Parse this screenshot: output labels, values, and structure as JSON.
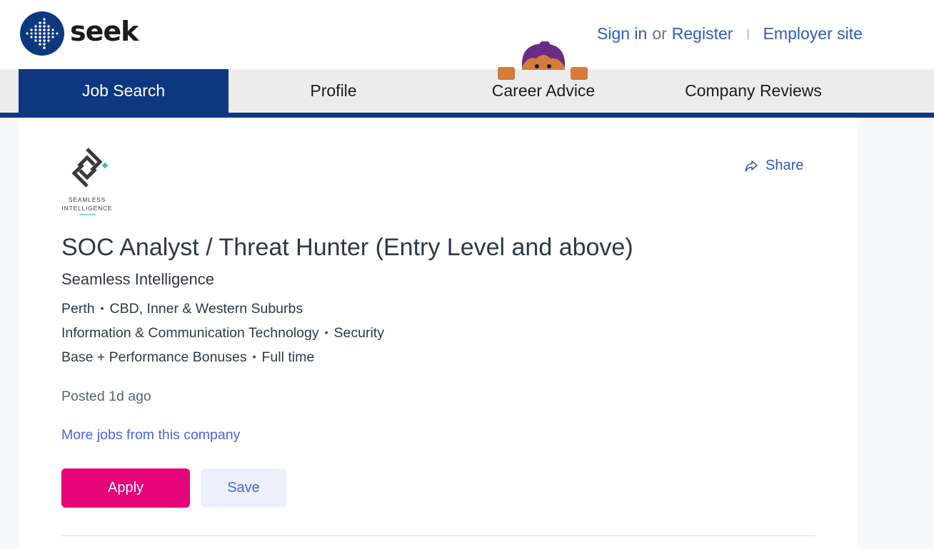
{
  "header": {
    "logo_text": "seek",
    "sign_in": "Sign in",
    "or": "or",
    "register": "Register",
    "separator": "|",
    "employer_site": "Employer site"
  },
  "nav": {
    "tabs": [
      {
        "label": "Job Search",
        "active": true
      },
      {
        "label": "Profile",
        "active": false
      },
      {
        "label": "Career Advice",
        "active": false
      },
      {
        "label": "Company Reviews",
        "active": false
      }
    ]
  },
  "job": {
    "company_logo_text_line1": "SEAMLESS",
    "company_logo_text_line2": "INTELLIGENCE",
    "share_label": "Share",
    "title": "SOC Analyst / Threat Hunter (Entry Level and above)",
    "company": "Seamless Intelligence",
    "location": "Perth",
    "area": "CBD, Inner & Western Suburbs",
    "classification": "Information & Communication Technology",
    "subclassification": "Security",
    "salary": "Base + Performance Bonuses",
    "work_type": "Full time",
    "posted": "Posted 1d ago",
    "more_jobs": "More jobs from this company",
    "apply_label": "Apply",
    "save_label": "Save"
  },
  "colors": {
    "brand_navy": "#0d3880",
    "apply_pink": "#e60278",
    "link_blue": "#2e5cb8",
    "action_blue": "#4964e9"
  }
}
